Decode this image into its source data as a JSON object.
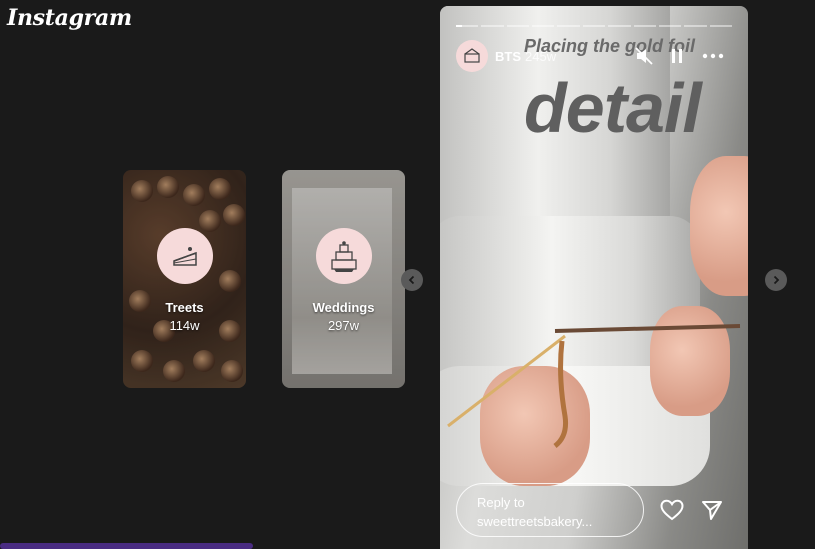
{
  "app": {
    "logo_text": "Instagram"
  },
  "highlights": [
    {
      "title": "Treets",
      "time": "114w",
      "icon": "cake-slice-icon"
    },
    {
      "title": "Weddings",
      "time": "297w",
      "icon": "wedding-cake-icon"
    }
  ],
  "story": {
    "username": "BTS",
    "time": "245w",
    "overlay_small": "Placing the gold foil",
    "overlay_big": "detail",
    "progress": [
      1,
      0,
      0,
      0,
      0,
      0,
      0,
      0,
      0,
      0,
      0
    ],
    "progress_current_fraction": 0.25,
    "reply_label": "Reply to",
    "reply_handle": "sweettreetsbakery...",
    "controls": [
      "mute-icon",
      "pause-icon",
      "more-icon"
    ],
    "actions": [
      "heart-icon",
      "send-icon"
    ]
  },
  "colors": {
    "background": "#1a1a1a",
    "avatar_bg": "#f6dada",
    "scrollbar": "#4a2c82"
  }
}
